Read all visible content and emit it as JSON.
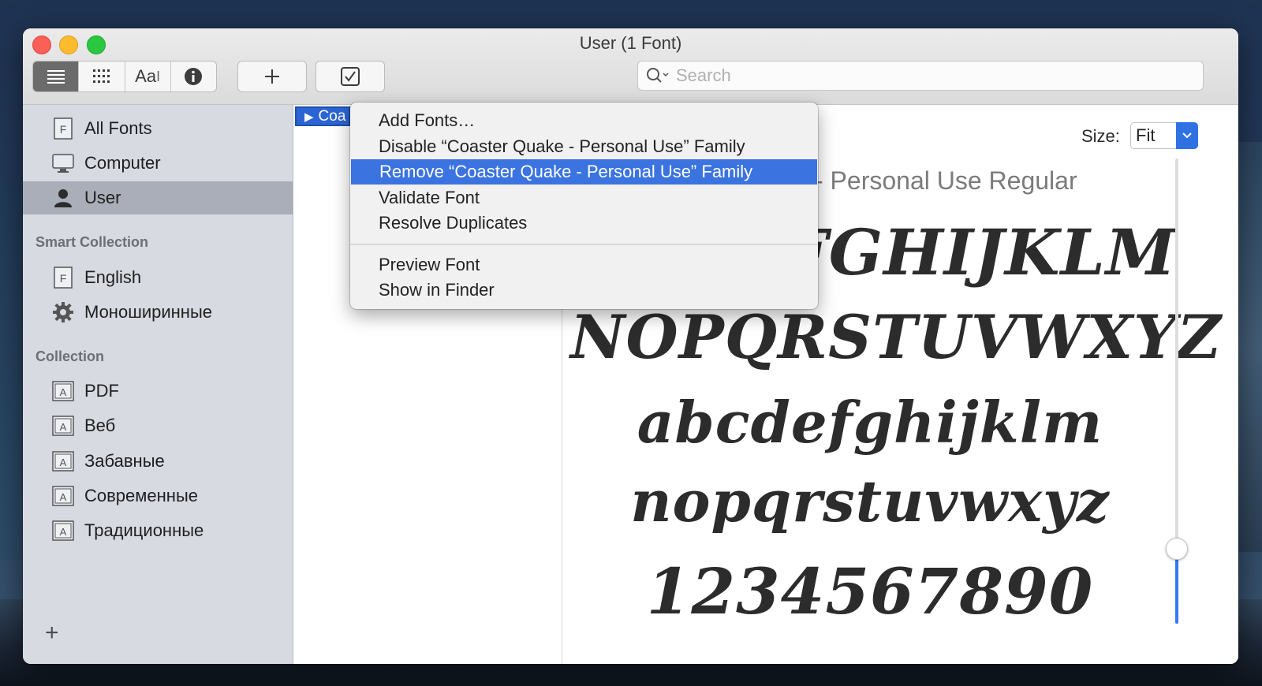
{
  "window": {
    "title": "User (1 Font)"
  },
  "toolbar": {
    "view_modes": [
      "list-view",
      "grid-view",
      "sample-view",
      "info-view"
    ],
    "sample_label": "Aa",
    "add_icon": "plus-icon",
    "validate_icon": "checkbox-icon",
    "search_placeholder": "Search"
  },
  "sidebar": {
    "library_items": [
      {
        "label": "All Fonts",
        "icon": "font-file-icon"
      },
      {
        "label": "Computer",
        "icon": "computer-icon"
      },
      {
        "label": "User",
        "icon": "user-icon",
        "selected": true
      }
    ],
    "smart_collection_heading": "Smart Collection",
    "smart_items": [
      {
        "label": "English",
        "icon": "font-file-icon"
      },
      {
        "label": "Моноширинные",
        "icon": "gear-icon"
      }
    ],
    "collection_heading": "Collection",
    "collection_items": [
      {
        "label": "PDF",
        "icon": "collection-icon"
      },
      {
        "label": "Веб",
        "icon": "collection-icon"
      },
      {
        "label": "Забавные",
        "icon": "collection-icon"
      },
      {
        "label": "Современные",
        "icon": "collection-icon"
      },
      {
        "label": "Традиционные",
        "icon": "collection-icon"
      }
    ],
    "add_label": "+"
  },
  "font_list": {
    "selected_row": "Coa"
  },
  "context_menu": {
    "items": [
      "Add Fonts…",
      "Disable “Coaster Quake - Personal Use” Family",
      "Remove “Coaster Quake - Personal Use” Family",
      "Validate Font",
      "Resolve Duplicates",
      "Preview Font",
      "Show in Finder"
    ],
    "highlighted_index": 2
  },
  "preview": {
    "size_label": "Size:",
    "size_value": "Fit",
    "font_name": "- Personal Use Regular",
    "sample_lines": [
      "FGHIJKLM",
      "NOPQRSTUVWXYZ",
      "abcdefghijklm",
      "nopqrstuvwxyz",
      "1234567890"
    ]
  },
  "colors": {
    "accent": "#3b73e0",
    "sidebar_bg": "#d7dae0",
    "sidebar_selected": "#a9aeb8"
  }
}
